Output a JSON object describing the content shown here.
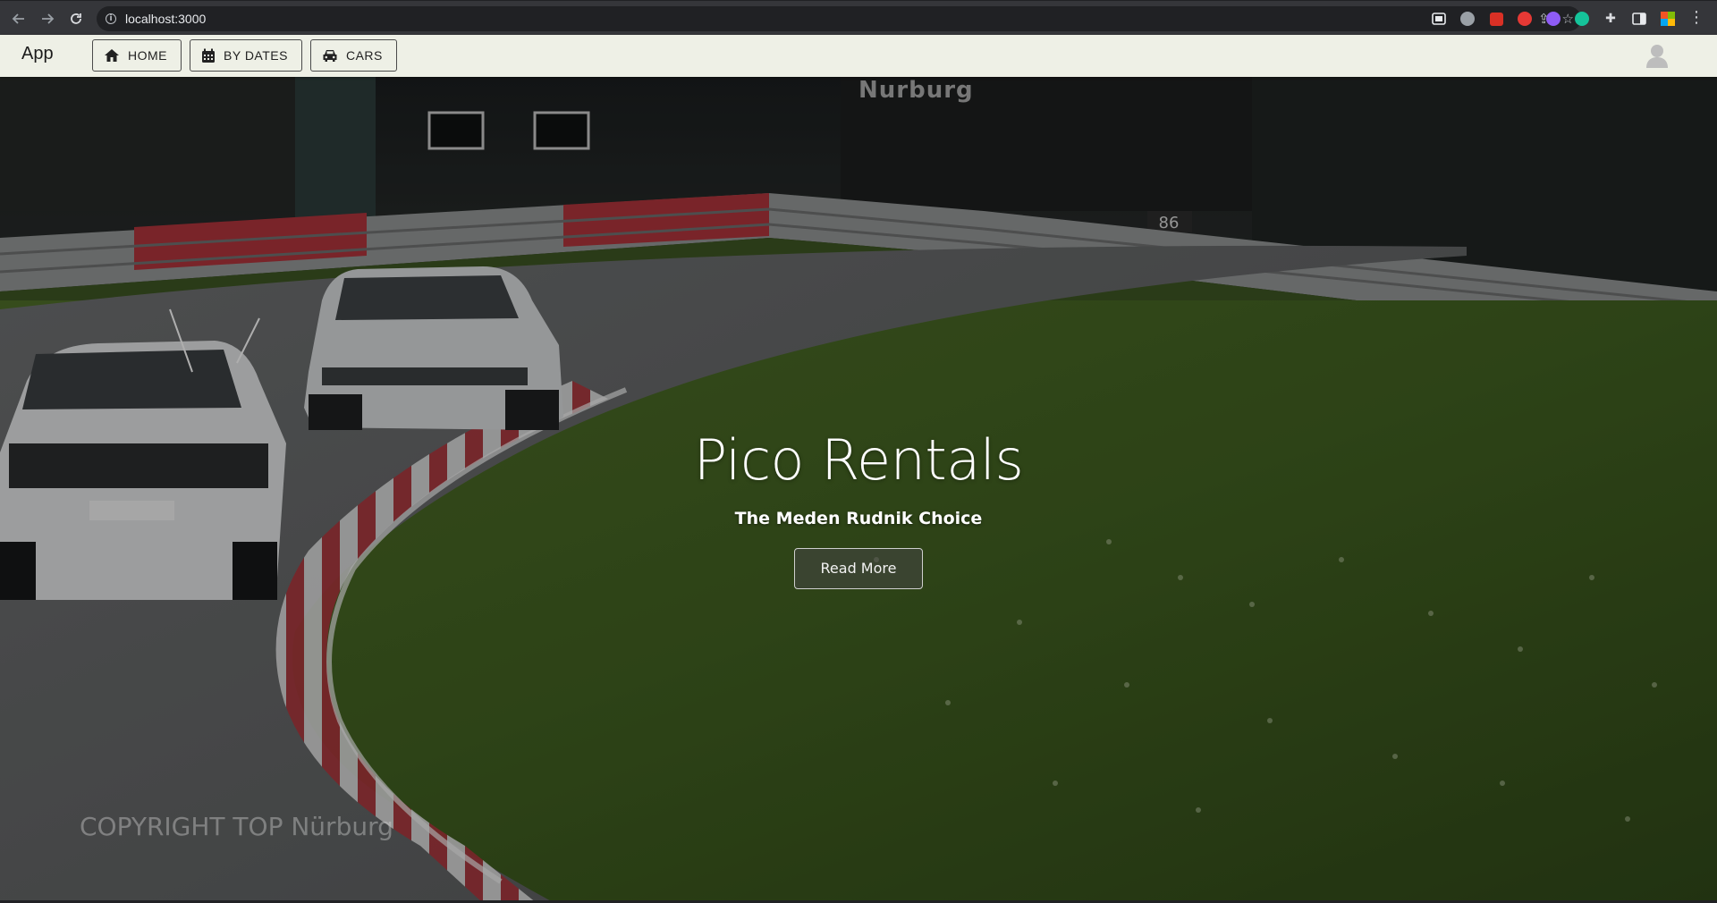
{
  "browser": {
    "url": "localhost:3000",
    "nav_icons": [
      "back-arrow-icon",
      "forward-arrow-icon",
      "reload-icon"
    ],
    "omnibox_actions": [
      "install-icon",
      "share-icon",
      "bookmark-star-icon"
    ],
    "extensions": [
      "screen-capture-icon",
      "extension-gray-icon",
      "extension-red-icon",
      "extension-redshield-icon",
      "extension-purple-icon",
      "grammarly-icon",
      "puzzle-extensions-icon",
      "side-panel-icon",
      "profile-flag-icon"
    ],
    "extension_colors": [
      "#e8eaed",
      "#9aa0a6",
      "#d93025",
      "#e53935",
      "#8e5cf5",
      "#15c39a"
    ]
  },
  "app": {
    "title": "App",
    "nav": [
      {
        "label": "HOME",
        "icon": "home-icon"
      },
      {
        "label": "BY DATES",
        "icon": "calendar-icon"
      },
      {
        "label": "CARS",
        "icon": "car-icon"
      }
    ],
    "avatar_icon": "user-avatar-icon"
  },
  "hero": {
    "title": "Pico Rentals",
    "subtitle": "The Meden Rudnik Choice",
    "button_label": "Read More",
    "watermark_top": "Nurburg",
    "copyright": "COPYRIGHT TOP Nürburg",
    "sign_number": "86"
  },
  "colors": {
    "app_bar_bg": "#eef0e6",
    "browser_bar_bg": "#35363a",
    "grass": "#3d5a1e",
    "asphalt": "#4a4a4a",
    "kerb_red": "#a8333a"
  }
}
